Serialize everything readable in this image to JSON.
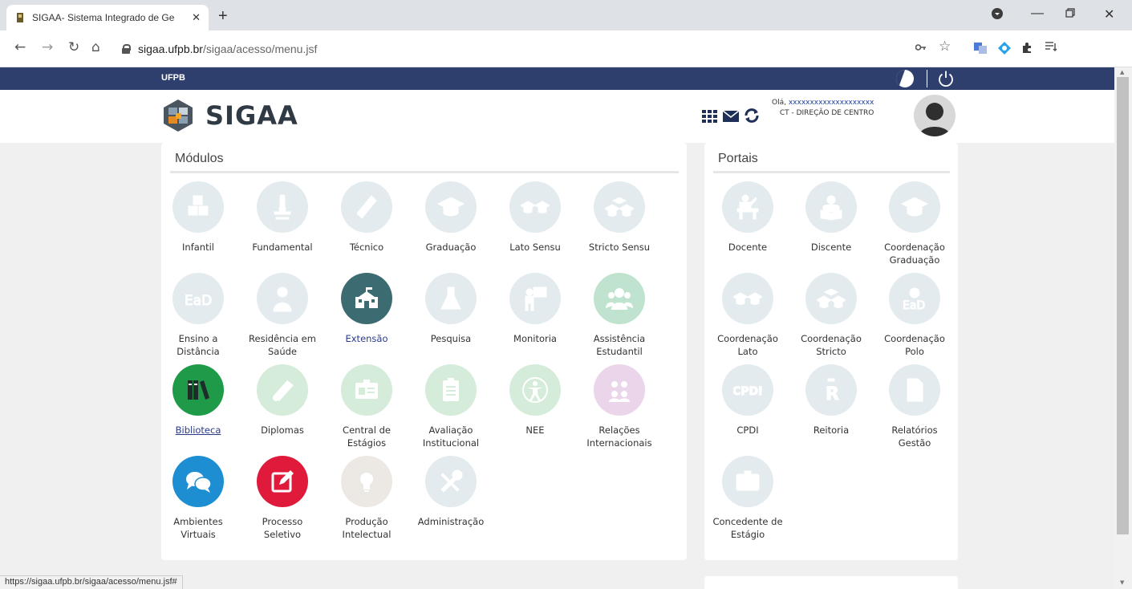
{
  "browser": {
    "tab_title": "SIGAA- Sistema Integrado de Ge",
    "url_host": "sigaa.ufpb.br",
    "url_path": "/sigaa/acesso/menu.jsf",
    "status_url": "https://sigaa.ufpb.br/sigaa/acesso/menu.jsf#"
  },
  "topbar": {
    "brand": "UFPB"
  },
  "header": {
    "logo_text": "SIGAA",
    "greeting": "Olá,",
    "user_name": "xxxxxxxxxxxxxxxxxxxx",
    "department": "CT - DIREÇÃO DE CENTRO"
  },
  "modules": {
    "title": "Módulos",
    "items": [
      {
        "label": "Infantil",
        "icon": "abc-blocks-icon",
        "active": false
      },
      {
        "label": "Fundamental",
        "icon": "microscope-icon",
        "active": false
      },
      {
        "label": "Técnico",
        "icon": "ruler-icon",
        "active": false
      },
      {
        "label": "Graduação",
        "icon": "graduation-cap-icon",
        "active": false
      },
      {
        "label": "Lato Sensu",
        "icon": "double-cap-icon",
        "active": false
      },
      {
        "label": "Stricto Sensu",
        "icon": "triple-cap-icon",
        "active": false
      },
      {
        "label": "Ensino a Distância",
        "icon": "ead-icon",
        "active": false
      },
      {
        "label": "Residência em Saúde",
        "icon": "doctor-icon",
        "active": false
      },
      {
        "label": "Extensão",
        "icon": "school-building-icon",
        "active": true,
        "color": "#3d6b72"
      },
      {
        "label": "Pesquisa",
        "icon": "flask-icon",
        "active": false
      },
      {
        "label": "Monitoria",
        "icon": "teacher-board-icon",
        "active": false
      },
      {
        "label": "Assistência Estudantil",
        "icon": "group-icon",
        "active": false,
        "color": "#bfe3cf"
      },
      {
        "label": "Biblioteca",
        "icon": "books-icon",
        "active": true,
        "color": "#1e9a49"
      },
      {
        "label": "Diplomas",
        "icon": "diploma-icon",
        "active": false,
        "color": "#d4ecd9"
      },
      {
        "label": "Central de Estágios",
        "icon": "badge-icon",
        "active": false,
        "color": "#d4ecd9"
      },
      {
        "label": "Avaliação Institucional",
        "icon": "clipboard-icon",
        "active": false,
        "color": "#d4ecd9"
      },
      {
        "label": "NEE",
        "icon": "accessibility-icon",
        "active": false,
        "color": "#d4ecd9"
      },
      {
        "label": "Relações Internacionais",
        "icon": "people-exchange-icon",
        "active": false,
        "color": "#ead5ea"
      },
      {
        "label": "Ambientes Virtuais",
        "icon": "chat-bubbles-icon",
        "active": true,
        "color": "#1d8ed2"
      },
      {
        "label": "Processo Seletivo",
        "icon": "edit-form-icon",
        "active": true,
        "color": "#e01a3b"
      },
      {
        "label": "Produção Intelectual",
        "icon": "lightbulb-icon",
        "active": false,
        "color": "#ece8e4"
      },
      {
        "label": "Administração",
        "icon": "tools-icon",
        "active": false
      }
    ]
  },
  "portals": {
    "title": "Portais",
    "items": [
      {
        "label": "Docente",
        "icon": "teacher-icon"
      },
      {
        "label": "Discente",
        "icon": "student-reading-icon"
      },
      {
        "label": "Coordenação Graduação",
        "icon": "graduation-cap-icon"
      },
      {
        "label": "Coordenação Lato",
        "icon": "double-cap-icon"
      },
      {
        "label": "Coordenação Stricto",
        "icon": "triple-cap-icon"
      },
      {
        "label": "Coordenação Polo",
        "icon": "ead-polo-icon"
      },
      {
        "label": "CPDI",
        "icon": "cpdi-icon"
      },
      {
        "label": "Reitoria",
        "icon": "reitoria-icon"
      },
      {
        "label": "Relatórios Gestão",
        "icon": "document-icon"
      },
      {
        "label": "Concedente de Estágio",
        "icon": "badge-icon"
      }
    ]
  }
}
